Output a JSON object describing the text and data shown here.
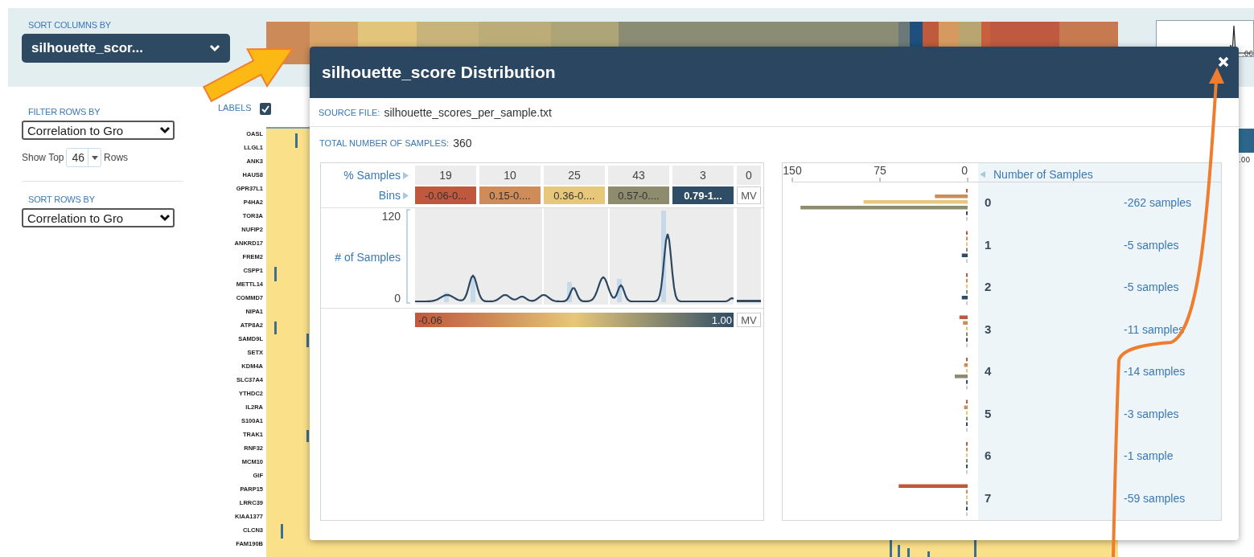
{
  "sort_columns": {
    "label": "SORT COLUMNS BY",
    "value": "silhouette_scor..."
  },
  "filter_rows": {
    "label": "FILTER ROWS BY",
    "value": "Correlation to Gro",
    "show_top_prefix": "Show Top",
    "show_top_value": "46",
    "show_top_suffix": "Rows"
  },
  "sort_rows": {
    "label": "SORT ROWS BY",
    "value": "Correlation to Gro"
  },
  "labels_toggle": {
    "label": "LABELS",
    "checked": true
  },
  "row_labels": [
    "OASL",
    "LLGL1",
    "ANK3",
    "HAUS8",
    "GPR37L1",
    "P4HA2",
    "TOR3A",
    "NUFIP2",
    "ANKRD17",
    "FREM2",
    "CSPP1",
    "METTL14",
    "COMMD7",
    "NIPA1",
    "ATP8A2",
    "SAMD9L",
    "SETX",
    "KDM4A",
    "SLC37A4",
    "YTHDC2",
    "IL2RA",
    "S100A1",
    "TRAK1",
    "RNF32",
    "MCM10",
    "GIF",
    "PARP15",
    "LRRC39",
    "KIAA1377",
    "CLCN3",
    "FAM190B"
  ],
  "right_edge_labels": [
    ".00",
    ".00"
  ],
  "dialog": {
    "title": "silhouette_score Distribution",
    "source_file": {
      "label": "SOURCE FILE:",
      "value": "silhouette_scores_per_sample.txt"
    },
    "total_samples": {
      "label": "TOTAL NUMBER OF SAMPLES:",
      "value": "360"
    },
    "distribution": {
      "percent_label": "% Samples",
      "bins_label": "Bins",
      "bins": [
        {
          "kind": "range",
          "percent": "19",
          "label": "-0.06-0...",
          "color": "#c0583d"
        },
        {
          "kind": "range",
          "percent": "10",
          "label": "0.15-0....",
          "color": "#cf8c58"
        },
        {
          "kind": "range",
          "percent": "25",
          "label": "0.36-0....",
          "color": "#e7c779"
        },
        {
          "kind": "range",
          "percent": "43",
          "label": "0.57-0....",
          "color": "#8e8c6f"
        },
        {
          "kind": "range",
          "percent": "3",
          "label": "0.79-1...",
          "color": "#2f4d66"
        },
        {
          "kind": "missing",
          "percent": "0",
          "label": "MV"
        }
      ],
      "y_axis": {
        "max": "120",
        "title": "# of Samples",
        "min": "0"
      },
      "gradient": {
        "min": "-0.06",
        "max": "1.00",
        "missing": "MV"
      }
    },
    "cluster_counts": {
      "header": "Number of Samples",
      "counts": [
        "-262 samples",
        "-5 samples",
        "-5 samples",
        "-11 samples",
        "-14 samples",
        "-3 samples",
        "-1 sample",
        "-59 samples"
      ],
      "chart_data": {
        "type": "bar",
        "orientation": "horizontal",
        "stacked": false,
        "categories": [
          "0",
          "1",
          "2",
          "3",
          "4",
          "5",
          "6",
          "7"
        ],
        "xlim": [
          150,
          0
        ],
        "xticks": [
          {
            "value": 150,
            "label": "150"
          },
          {
            "value": 75,
            "label": "75"
          },
          {
            "value": 0,
            "label": "0"
          }
        ],
        "series": [
          {
            "color": "#c0583d",
            "values": [
              1,
              0,
              0,
              7,
              0,
              0,
              1,
              59
            ]
          },
          {
            "color": "#cf8c58",
            "values": [
              28,
              0,
              0,
              4,
              3,
              3,
              0,
              0
            ]
          },
          {
            "color": "#e7c779",
            "values": [
              89,
              0,
              0,
              0,
              0,
              0,
              0,
              0
            ]
          },
          {
            "color": "#8e8c6f",
            "values": [
              143,
              0,
              0,
              0,
              11,
              0,
              0,
              0
            ]
          },
          {
            "color": "#2f4d66",
            "values": [
              1,
              5,
              5,
              0,
              0,
              0,
              0,
              0
            ]
          },
          {
            "color": "#cccccc",
            "values": [
              0,
              0,
              0,
              0,
              0,
              0,
              0,
              0
            ]
          }
        ]
      }
    }
  }
}
